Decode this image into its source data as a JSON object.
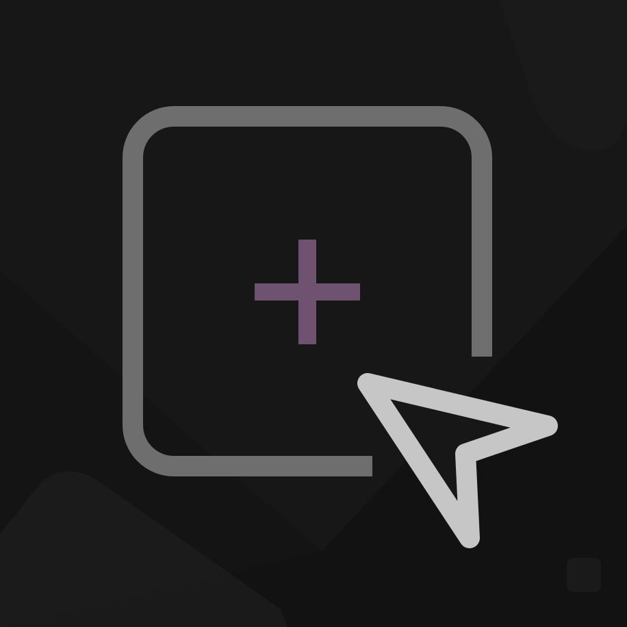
{
  "colors": {
    "background": "#171717",
    "background_shade": "#121212",
    "background_light": "#1e1e1e",
    "frame_stroke": "#6e6e6e",
    "plus_accent": "#6e5270",
    "cursor_stroke": "#c6c6c6",
    "cursor_fill": "#171717"
  },
  "icon": {
    "name": "add-selection-icon",
    "parts": [
      "selection-frame",
      "plus-sign",
      "pointer-cursor"
    ]
  }
}
